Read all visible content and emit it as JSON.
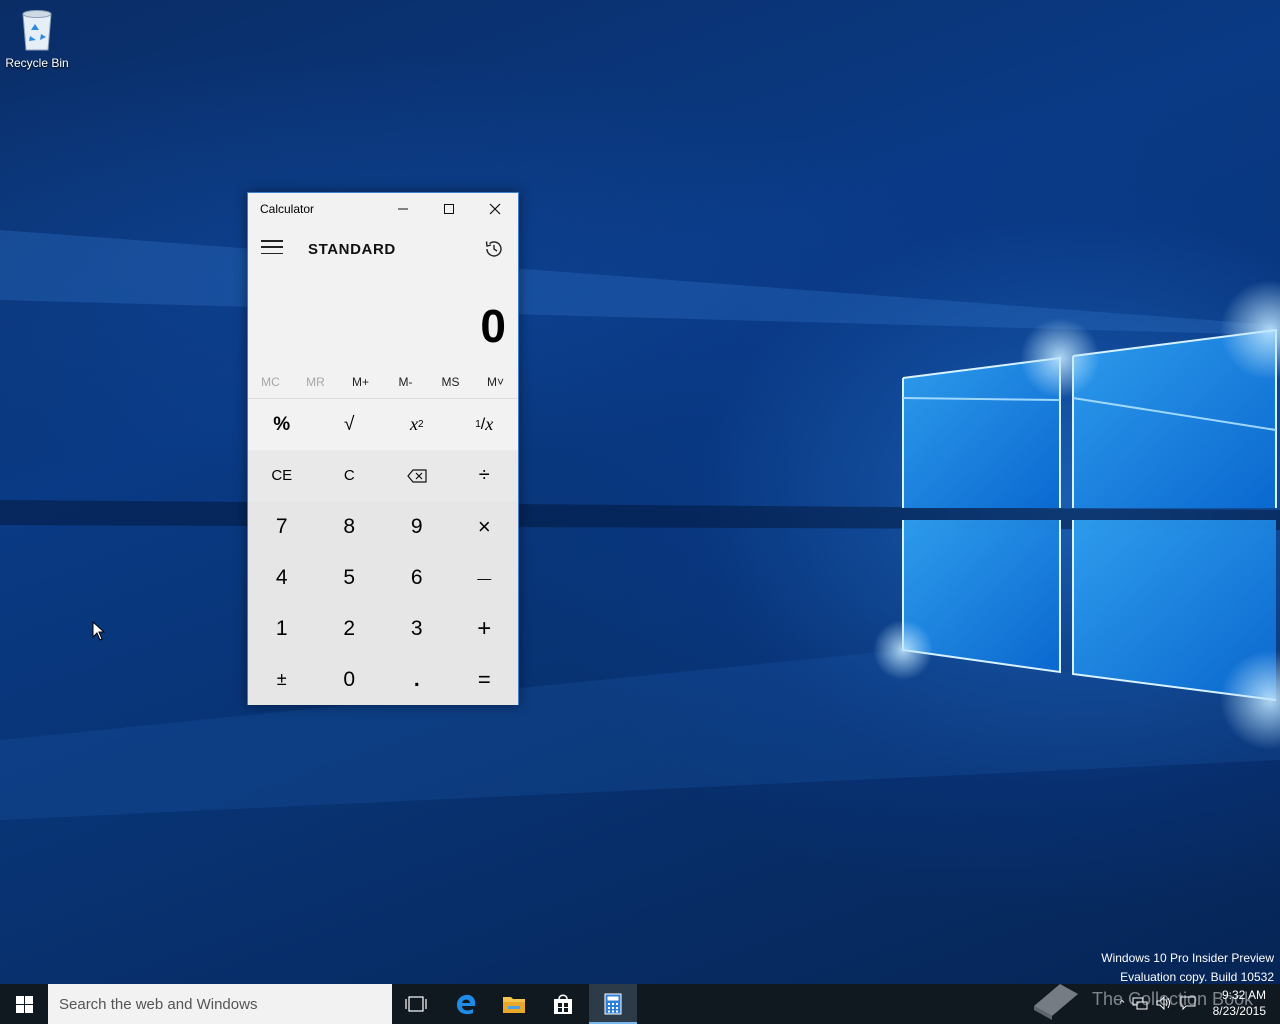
{
  "desktop": {
    "icons": [
      {
        "label": "Recycle Bin",
        "icon": "recycle-bin-icon"
      }
    ],
    "watermark": [
      "Windows 10 Pro Insider Preview",
      "Evaluation copy. Build 10532"
    ],
    "brand_watermark": "The Collection Book"
  },
  "calculator": {
    "window_title": "Calculator",
    "mode": "STANDARD",
    "display_value": "0",
    "memory_buttons": [
      {
        "label": "MC",
        "enabled": false
      },
      {
        "label": "MR",
        "enabled": false
      },
      {
        "label": "M+",
        "enabled": true
      },
      {
        "label": "M-",
        "enabled": true
      },
      {
        "label": "MS",
        "enabled": true
      },
      {
        "label": "M˅",
        "enabled": true
      }
    ],
    "keys": {
      "percent": "%",
      "sqrt": "√",
      "square_base": "x",
      "square_exp": "2",
      "reciprocal_num": "1",
      "reciprocal_den": "x",
      "ce": "CE",
      "c": "C",
      "divide": "÷",
      "d7": "7",
      "d8": "8",
      "d9": "9",
      "multiply": "×",
      "d4": "4",
      "d5": "5",
      "d6": "6",
      "subtract": "—",
      "d1": "1",
      "d2": "2",
      "d3": "3",
      "add": "+",
      "negate": "±",
      "d0": "0",
      "decimal": ".",
      "equals": "="
    }
  },
  "taskbar": {
    "search_placeholder": "Search the web and Windows",
    "pinned": [
      "task-view-icon",
      "edge-icon",
      "file-explorer-icon",
      "store-icon",
      "calculator-icon"
    ],
    "active_app": "calculator",
    "clock_time": "9:32 AM",
    "clock_date": "8/23/2015"
  },
  "colors": {
    "accent": "#3c7ec9",
    "taskbar": "#101820",
    "calc_bg": "#f2f2f2",
    "numpad_bg": "#e6e6e6"
  }
}
